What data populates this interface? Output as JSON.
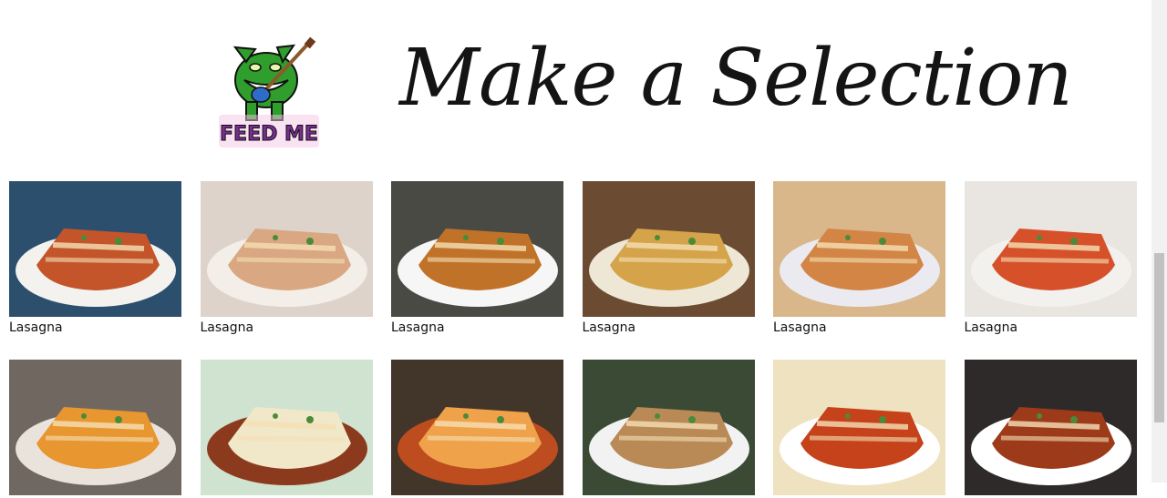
{
  "header": {
    "logo_text": "FEED ME",
    "title": "Make a Selection"
  },
  "recipes": [
    {
      "name": "Lasagna",
      "plate": "#f4f2ee",
      "food": "#c4552a",
      "bg": "#2d4f6e"
    },
    {
      "name": "Lasagna",
      "plate": "#f3efe8",
      "food": "#d9a782",
      "bg": "#ddd3cb"
    },
    {
      "name": "Lasagna",
      "plate": "#f6f6f6",
      "food": "#c07228",
      "bg": "#4a4a44"
    },
    {
      "name": "Lasagna",
      "plate": "#efe7d5",
      "food": "#d4a34a",
      "bg": "#6b4c32"
    },
    {
      "name": "Lasagna",
      "plate": "#eaeaf0",
      "food": "#d28545",
      "bg": "#d9b78b"
    },
    {
      "name": "Lasagna",
      "plate": "#f3f1ee",
      "food": "#d6512a",
      "bg": "#e9e6e1"
    },
    {
      "name": "",
      "plate": "#e9e3db",
      "food": "#e8962f",
      "bg": "#6f6760"
    },
    {
      "name": "",
      "plate": "#8c3a1e",
      "food": "#f1e7c9",
      "bg": "#cfe3d0"
    },
    {
      "name": "",
      "plate": "#bd4c1f",
      "food": "#f0a24a",
      "bg": "#423529"
    },
    {
      "name": "",
      "plate": "#f2f2f2",
      "food": "#b98956",
      "bg": "#3a4a34"
    },
    {
      "name": "",
      "plate": "#ffffff",
      "food": "#c5421a",
      "bg": "#efe2c0"
    },
    {
      "name": "",
      "plate": "#ffffff",
      "food": "#9d3a1a",
      "bg": "#2f2a2a"
    }
  ]
}
